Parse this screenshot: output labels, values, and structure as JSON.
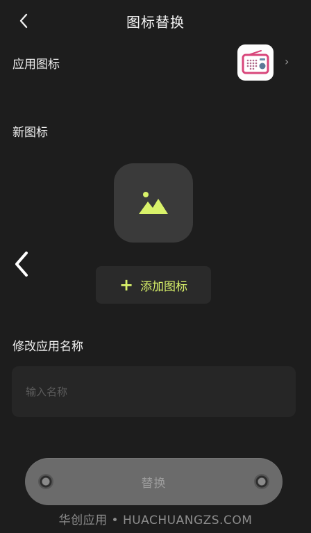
{
  "header": {
    "title": "图标替换",
    "back_icon": "chevron-left-icon"
  },
  "app_icon_row": {
    "label": "应用图标",
    "thumbnail_icon": "radio-icon",
    "chevron": "›"
  },
  "new_icon_section": {
    "label": "新图标",
    "placeholder_icon": "image-icon",
    "add_button": {
      "plus": "+",
      "label": "添加图标"
    }
  },
  "side_nav": {
    "icon": "chevron-left-icon"
  },
  "rename_section": {
    "label": "修改应用名称",
    "input_value": "",
    "input_placeholder": "输入名称"
  },
  "replace_button": {
    "label": "替换"
  },
  "watermark": {
    "text": "华创应用 • HUACHUANGZS.COM"
  },
  "colors": {
    "background": "#1d1d1d",
    "accent": "#d9f26a",
    "card": "#3a3a3a",
    "button_disabled": "#6b6b6b",
    "radio_pink": "#d8457a"
  }
}
